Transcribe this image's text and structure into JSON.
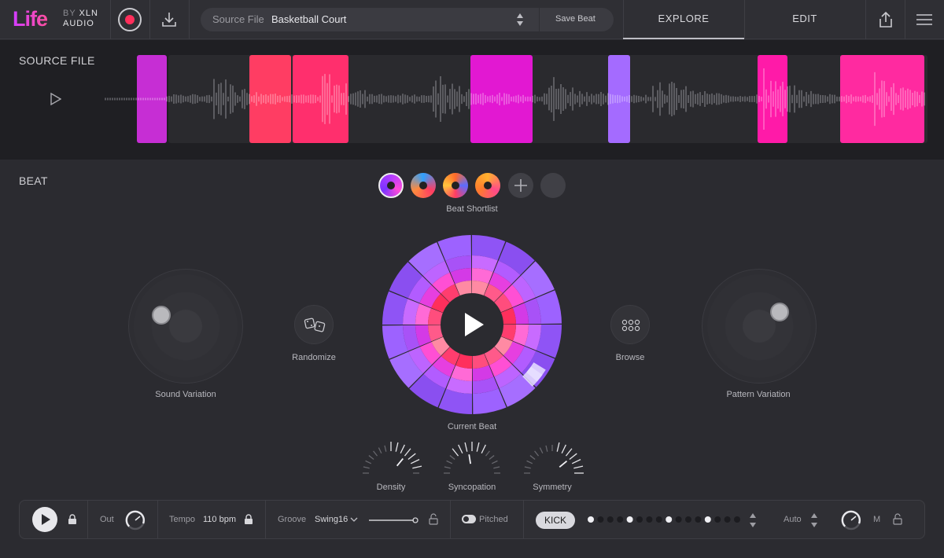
{
  "app": {
    "logo": "Life",
    "logo_by": "BY",
    "logo_brand_line1": "XLN",
    "logo_brand_line2": "AUDIO"
  },
  "header": {
    "source_label": "Source File",
    "source_value": "Basketball Court",
    "save_beat": "Save Beat",
    "tabs": [
      {
        "label": "EXPLORE",
        "active": true
      },
      {
        "label": "EDIT",
        "active": false
      }
    ]
  },
  "source_section": {
    "title": "SOURCE FILE"
  },
  "beat_section": {
    "title": "BEAT",
    "shortlist_label": "Beat Shortlist",
    "sound_variation": "Sound Variation",
    "randomize": "Randomize",
    "current_beat": "Current Beat",
    "browse": "Browse",
    "pattern_variation": "Pattern Variation",
    "knobs": [
      {
        "label": "Density"
      },
      {
        "label": "Syncopation"
      },
      {
        "label": "Symmetry"
      }
    ]
  },
  "bottom_bar": {
    "out_label": "Out",
    "tempo_label": "Tempo",
    "tempo_value": "110 bpm",
    "groove_label": "Groove",
    "groove_value": "Swing16",
    "pitched_label": "Pitched",
    "kick_label": "KICK",
    "auto_label": "Auto",
    "m_label": "M"
  },
  "colors": {
    "accent_purple": "#9b5cff",
    "accent_pink": "#ff2e8a",
    "accent_red": "#ff3d63",
    "magenta": "#e21bd6"
  }
}
